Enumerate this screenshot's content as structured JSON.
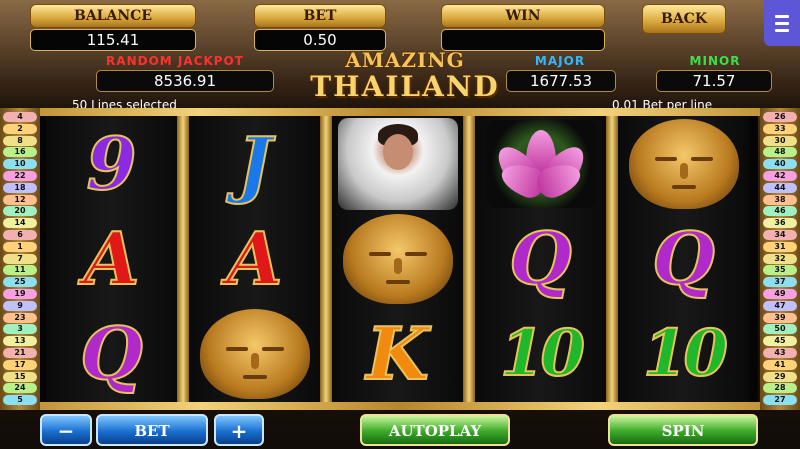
{
  "header": {
    "balance_label": "BALANCE",
    "balance_value": "115.41",
    "bet_label": "BET",
    "bet_value": "0.50",
    "win_label": "WIN",
    "win_value": "",
    "back_label": "BACK"
  },
  "jackpots": {
    "random_label": "RANDOM JACKPOT",
    "random_value": "8536.91",
    "major_label": "MAJOR",
    "major_value": "1677.53",
    "minor_label": "MINOR",
    "minor_value": "71.57"
  },
  "logo": {
    "line1": "AMAZING",
    "line2": "THAILAND"
  },
  "info": {
    "lines_selected": "50 Lines selected",
    "bet_per_line": "0.01 Bet per line"
  },
  "reels": [
    [
      {
        "kind": "letter",
        "text": "9",
        "color": "#8a2be2"
      },
      {
        "kind": "letter",
        "text": "A",
        "color": "#e01818"
      },
      {
        "kind": "letter",
        "text": "Q",
        "color": "#b02acb"
      }
    ],
    [
      {
        "kind": "letter",
        "text": "J",
        "color": "#1a78e8"
      },
      {
        "kind": "letter",
        "text": "A",
        "color": "#e01818"
      },
      {
        "kind": "buddha"
      }
    ],
    [
      {
        "kind": "lady"
      },
      {
        "kind": "buddha"
      },
      {
        "kind": "letter",
        "text": "K",
        "color": "#f28a10"
      }
    ],
    [
      {
        "kind": "lotus"
      },
      {
        "kind": "letter",
        "text": "Q",
        "color": "#b02acb"
      },
      {
        "kind": "ten",
        "text": "10",
        "color": "#1fb82a"
      }
    ],
    [
      {
        "kind": "buddha"
      },
      {
        "kind": "letter",
        "text": "Q",
        "color": "#b02acb"
      },
      {
        "kind": "ten",
        "text": "10",
        "color": "#1fb82a"
      }
    ]
  ],
  "left_lines": [
    "4",
    "2",
    "8",
    "16",
    "10",
    "22",
    "18",
    "12",
    "20",
    "14",
    "6",
    "1",
    "7",
    "11",
    "25",
    "19",
    "9",
    "23",
    "3",
    "13",
    "21",
    "17",
    "15",
    "24",
    "5"
  ],
  "right_lines": [
    "26",
    "33",
    "30",
    "48",
    "40",
    "42",
    "44",
    "38",
    "46",
    "36",
    "34",
    "31",
    "32",
    "35",
    "37",
    "49",
    "47",
    "39",
    "50",
    "45",
    "43",
    "41",
    "29",
    "28",
    "27"
  ],
  "line_colors": [
    "#f3b0b0",
    "#ffd27a",
    "#f0e08a",
    "#b8f08a",
    "#8ae0f0",
    "#f5a0e0",
    "#c0c0ff",
    "#ffc090",
    "#a0f0c0",
    "#f0f0a0"
  ],
  "buttons": {
    "minus": "−",
    "bet": "BET",
    "plus": "+",
    "autoplay": "AUTOPLAY",
    "spin": "SPIN"
  },
  "colors": {
    "random_label": "#ff3030",
    "major_label": "#35b6ff",
    "minor_label": "#3be04a"
  }
}
